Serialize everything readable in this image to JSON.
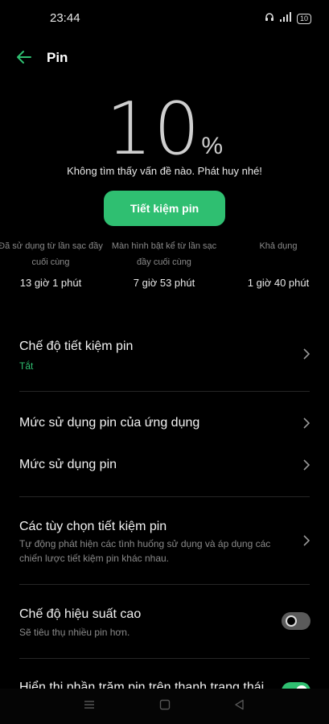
{
  "status_bar": {
    "time": "23:44",
    "battery": "10"
  },
  "header": {
    "title": "Pin"
  },
  "hero": {
    "percent": "10",
    "unit": "%",
    "message": "Không tìm thấy vấn đề nào. Phát huy nhé!"
  },
  "save_button": {
    "label": "Tiết kiệm pin"
  },
  "stats": [
    {
      "label_line1": "Đã sử dụng từ lần sạc đầy",
      "label_line2": "cuối cùng",
      "value": "13 giờ 1 phút"
    },
    {
      "label_line1": "Màn hình bật kể từ lần sạc",
      "label_line2": "đầy cuối cùng",
      "value": "7 giờ 53 phút"
    },
    {
      "label_line1": "Khả dụng",
      "label_line2": "",
      "value": "1 giờ 40 phút"
    }
  ],
  "settings": {
    "power_saving_mode": {
      "title": "Chế độ tiết kiệm pin",
      "status": "Tắt"
    },
    "app_battery_usage": {
      "title": "Mức sử dụng pin của ứng dụng"
    },
    "battery_usage": {
      "title": "Mức sử dụng pin"
    },
    "saving_options": {
      "title": "Các tùy chọn tiết kiệm pin",
      "description": "Tự động phát hiện các tình huống sử dụng và áp dụng các chiến lược tiết kiệm pin khác nhau."
    },
    "high_performance": {
      "title": "Chế độ hiệu suất cao",
      "description": "Sẽ tiêu thụ nhiều pin hơn.",
      "enabled": false
    },
    "show_percentage": {
      "title": "Hiển thị phần trăm pin trên thanh trạng thái",
      "enabled": true
    }
  },
  "colors": {
    "accent": "#2fbf71",
    "background": "#000000"
  }
}
